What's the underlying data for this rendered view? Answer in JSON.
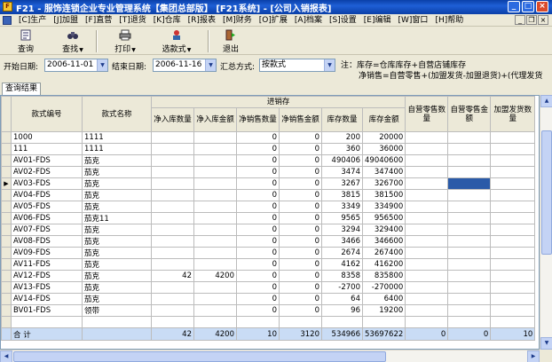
{
  "window": {
    "title": "F21 - 服饰连锁企业专业管理系统【集团总部版】 [F21系统] - [公司入销报表]"
  },
  "menu": [
    "[C]生产",
    "[J]加盟",
    "[F]直营",
    "[T]退货",
    "[K]仓库",
    "[R]报表",
    "[M]财务",
    "[O]扩展",
    "[A]档案",
    "[S]设置",
    "[E]编辑",
    "[W]窗口",
    "[H]帮助"
  ],
  "toolbar": {
    "query": "查询",
    "find": "查找",
    "print": "打印",
    "select_style": "选款式",
    "exit": "退出"
  },
  "filter": {
    "start_label": "开始日期:",
    "start_value": "2006-11-01",
    "end_label": "结束日期:",
    "end_value": "2006-11-16",
    "summary_label": "汇总方式:",
    "summary_value": "按款式",
    "note1": "注：库存=仓库库存+自营店铺库存",
    "note2": "净销售=自营零售+(加盟发货-加盟退货)+(代理发货"
  },
  "tab": "查询结果",
  "columns": {
    "code": "款式编号",
    "name": "款式名称",
    "group": "进销存",
    "in_qty": "净入库数量",
    "in_amt": "净入库金额",
    "sale_qty": "净销售数量",
    "sale_amt": "净销售金额",
    "stock_qty": "库存数量",
    "stock_amt": "库存金额",
    "retail_qty": "自营零售数量",
    "retail_amt": "自营零售金额",
    "fr_qty": "加盟发货数量"
  },
  "rows": [
    [
      "1000",
      "1111",
      "",
      "",
      "0",
      "0",
      "200",
      "20000",
      "",
      "",
      ""
    ],
    [
      "111",
      "1111",
      "",
      "",
      "0",
      "0",
      "360",
      "36000",
      "",
      "",
      ""
    ],
    [
      "AV01-FDS",
      "茄克",
      "",
      "",
      "0",
      "0",
      "490406",
      "49040600",
      "",
      "",
      ""
    ],
    [
      "AV02-FDS",
      "茄克",
      "",
      "",
      "0",
      "0",
      "3474",
      "347400",
      "",
      "",
      ""
    ],
    [
      "AV03-FDS",
      "茄克",
      "",
      "",
      "0",
      "0",
      "3267",
      "326700",
      "",
      "",
      ""
    ],
    [
      "AV04-FDS",
      "茄克",
      "",
      "",
      "0",
      "0",
      "3815",
      "381500",
      "",
      "",
      ""
    ],
    [
      "AV05-FDS",
      "茄克",
      "",
      "",
      "0",
      "0",
      "3349",
      "334900",
      "",
      "",
      ""
    ],
    [
      "AV06-FDS",
      "茄克11",
      "",
      "",
      "0",
      "0",
      "9565",
      "956500",
      "",
      "",
      ""
    ],
    [
      "AV07-FDS",
      "茄克",
      "",
      "",
      "0",
      "0",
      "3294",
      "329400",
      "",
      "",
      ""
    ],
    [
      "AV08-FDS",
      "茄克",
      "",
      "",
      "0",
      "0",
      "3466",
      "346600",
      "",
      "",
      ""
    ],
    [
      "AV09-FDS",
      "茄克",
      "",
      "",
      "0",
      "0",
      "2674",
      "267400",
      "",
      "",
      ""
    ],
    [
      "AV11-FDS",
      "茄克",
      "",
      "",
      "0",
      "0",
      "4162",
      "416200",
      "",
      "",
      ""
    ],
    [
      "AV12-FDS",
      "茄克",
      "42",
      "4200",
      "0",
      "0",
      "8358",
      "835800",
      "",
      "",
      ""
    ],
    [
      "AV13-FDS",
      "茄克",
      "",
      "",
      "0",
      "0",
      "-2700",
      "-270000",
      "",
      "",
      ""
    ],
    [
      "AV14-FDS",
      "茄克",
      "",
      "",
      "0",
      "0",
      "64",
      "6400",
      "",
      "",
      ""
    ],
    [
      "BV01-FDS",
      "领带",
      "",
      "",
      "0",
      "0",
      "96",
      "19200",
      "",
      "",
      ""
    ]
  ],
  "total": [
    "合 计",
    "",
    "42",
    "4200",
    "10",
    "3120",
    "534966",
    "53697622",
    "0",
    "0",
    "10"
  ]
}
